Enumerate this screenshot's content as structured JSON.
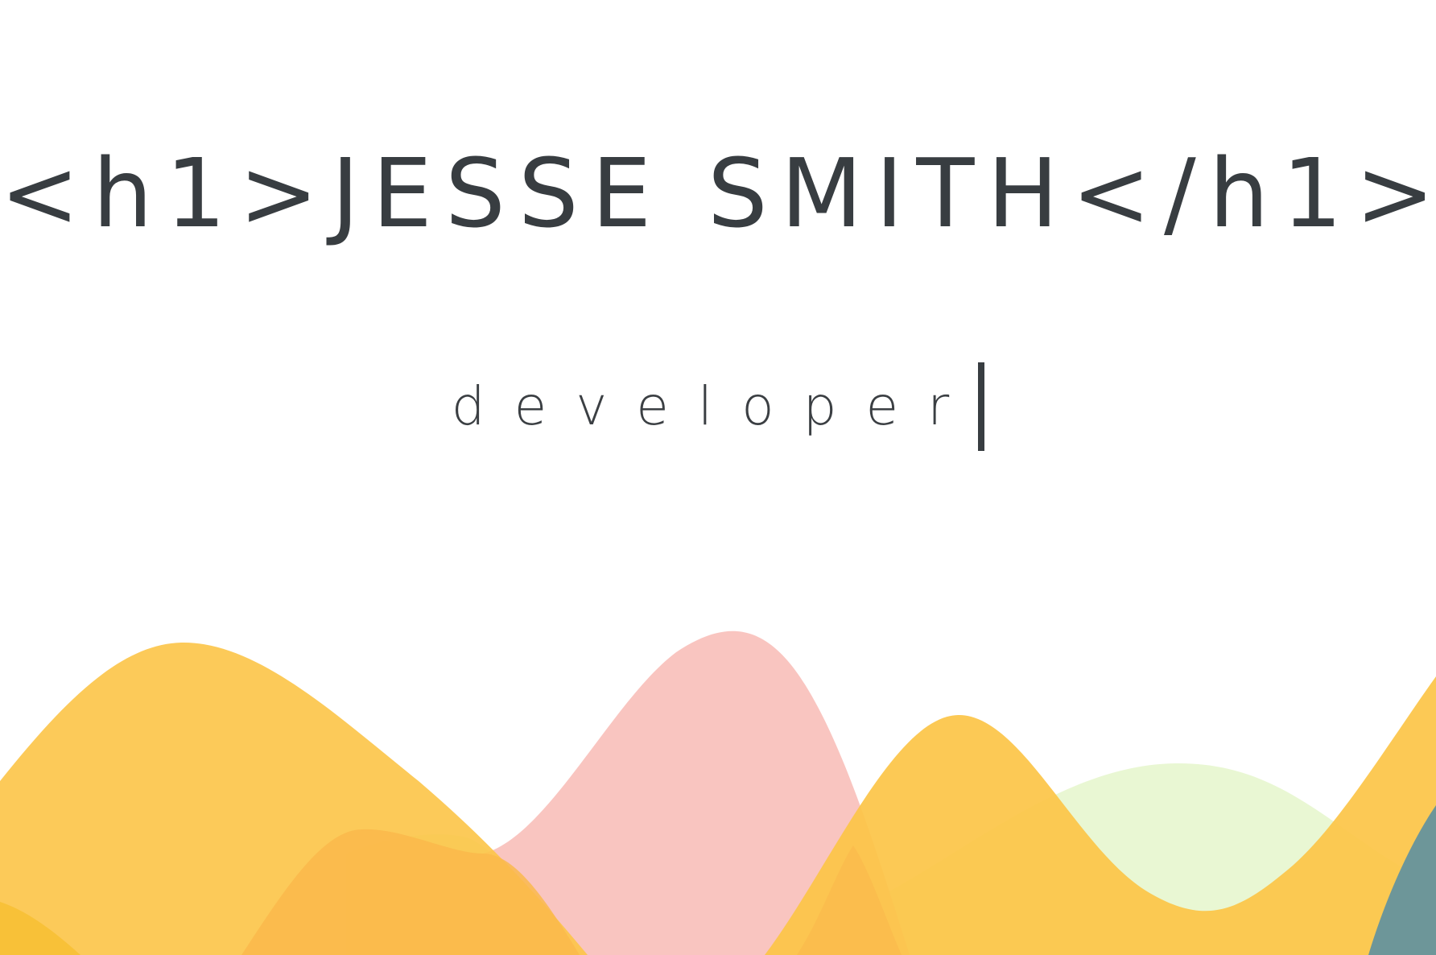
{
  "hero": {
    "title": "<h1>JESSE SMITH</h1>",
    "subtitle": "developer"
  },
  "colors": {
    "background": "#ffffff",
    "text": "#383d41",
    "wave_yellow": "#fcc447",
    "wave_pink": "#f9c2bd",
    "wave_light_green": "#e8f7d1",
    "wave_orange": "#fab84b",
    "wave_slate": "#6d9699"
  },
  "decorations": {
    "cursor": "text-cursor",
    "background_art": "layered-waves"
  }
}
